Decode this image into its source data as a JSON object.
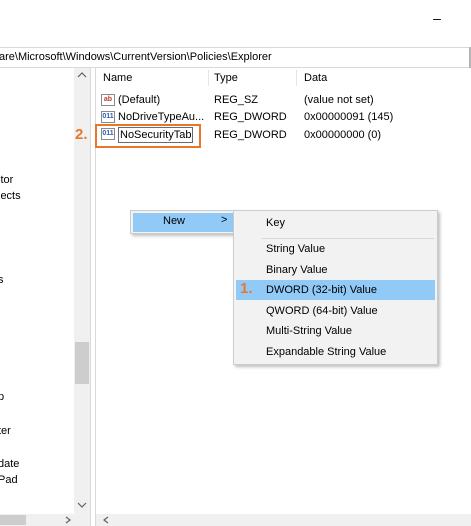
{
  "window": {
    "minimize_glyph": "–",
    "address": "are\\Microsoft\\Windows\\CurrentVersion\\Policies\\Explorer"
  },
  "tree": {
    "items": [
      "itor",
      "jects",
      "s",
      "p",
      "ter",
      "date",
      "Pad"
    ]
  },
  "list": {
    "columns": {
      "name": "Name",
      "type": "Type",
      "data": "Data"
    },
    "rows": [
      {
        "icon": "string-value-icon",
        "icon_text": "ab",
        "name": "(Default)",
        "type": "REG_SZ",
        "data": "(value not set)"
      },
      {
        "icon": "dword-value-icon",
        "icon_text": "011",
        "name": "NoDriveTypeAu...",
        "type": "REG_DWORD",
        "data": "0x00000091 (145)"
      },
      {
        "icon": "dword-value-icon",
        "icon_text": "011",
        "name": "NoSecurityTab",
        "type": "REG_DWORD",
        "data": "0x00000000 (0)"
      }
    ]
  },
  "annotations": {
    "step1": "1.",
    "step2": "2.",
    "color": "#e8772e"
  },
  "context_menu": {
    "new_label": "New",
    "caret": ">",
    "submenu": [
      "Key",
      "String Value",
      "Binary Value",
      "DWORD (32-bit) Value",
      "QWORD (64-bit) Value",
      "Multi-String Value",
      "Expandable String Value"
    ],
    "highlight_color": "#91c9f7"
  }
}
